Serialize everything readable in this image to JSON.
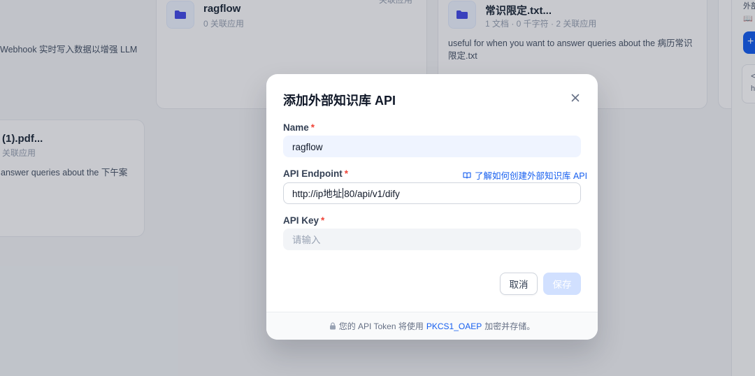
{
  "background": {
    "cards": [
      {
        "title": "ragflow",
        "meta": "0 关联应用"
      },
      {
        "title": "常识限定.txt...",
        "meta": "1 文档 · 0 千字符 · 2 关联应用",
        "description": "useful for when you want to answer queries about the 病历常识限定.txt"
      },
      {
        "title": "(1).pdf...",
        "meta": "关联应用",
        "description": "answer queries about the 下午案"
      }
    ],
    "left_fragment": "Webhook 实时写入数据以增强 LLM",
    "top_fragment": "关联应用",
    "right_panel": {
      "title": "外部",
      "link": "📖",
      "button": "+",
      "box_a": "<",
      "box_b": "h"
    }
  },
  "modal": {
    "title": "添加外部知识库 API",
    "required_mark": "*",
    "name_label": "Name",
    "name_value": "ragflow",
    "endpoint_label": "API Endpoint",
    "help_link": "了解如何创建外部知识库 API",
    "endpoint_before_caret": "http://ip地址",
    "endpoint_after_caret": "80/api/v1/dify",
    "apikey_label": "API Key",
    "apikey_placeholder": "请输入",
    "cancel_label": "取消",
    "save_label": "保存",
    "footer_prefix": "您的 API Token 将使用",
    "footer_highlight": "PKCS1_OAEP",
    "footer_suffix": "加密并存储。"
  },
  "colors": {
    "accent": "#155eef",
    "required": "#f04438",
    "save_disabled": "#d1e0ff"
  }
}
